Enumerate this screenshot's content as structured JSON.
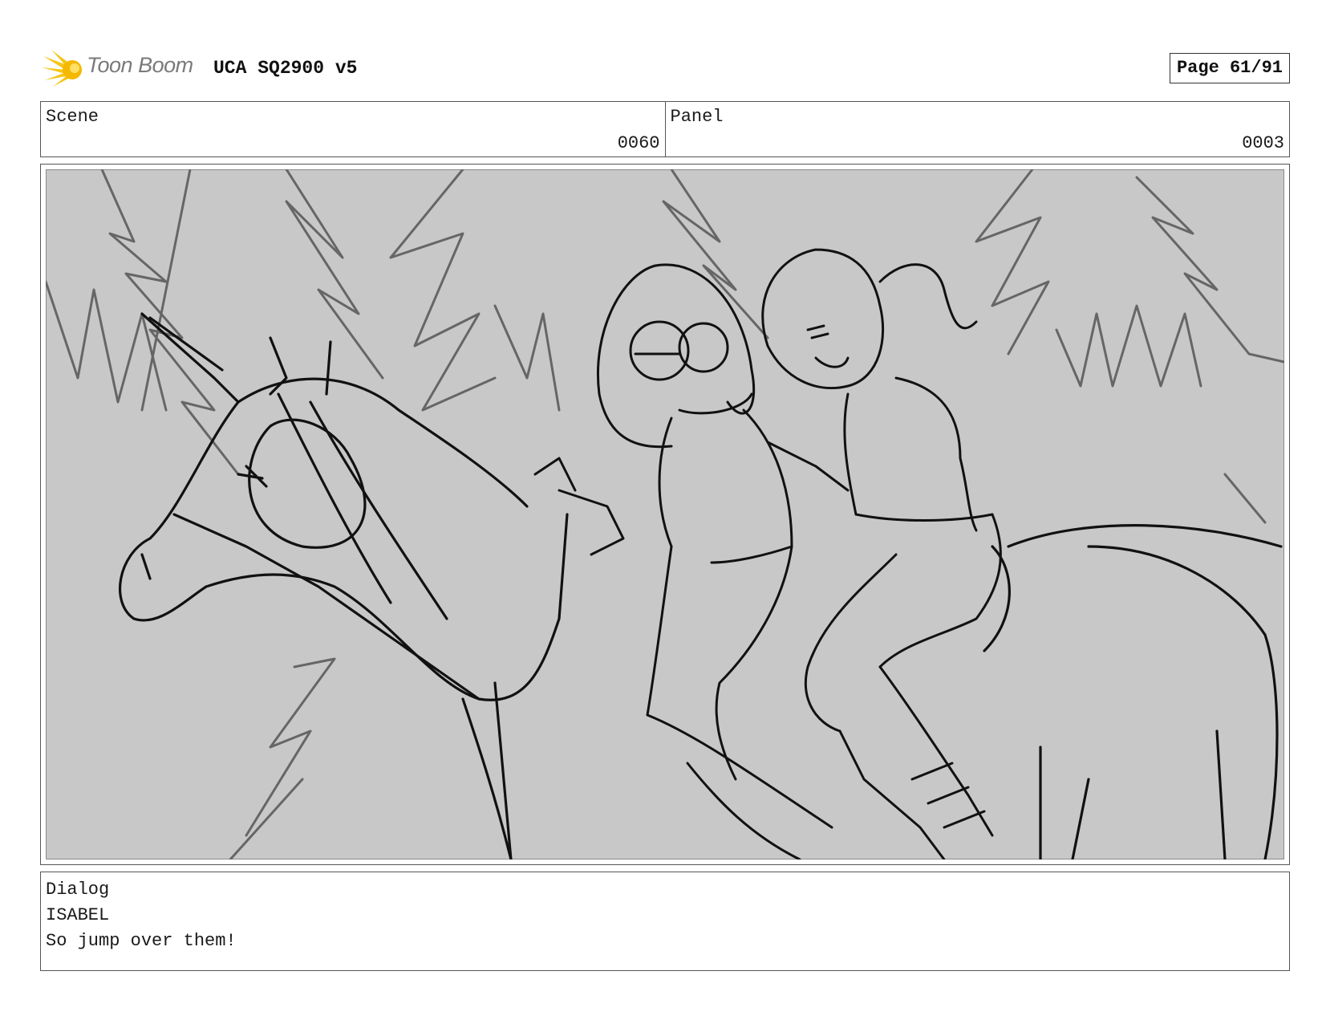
{
  "header": {
    "brand_name": "Toon Boom",
    "document_title": "UCA SQ2900 v5",
    "page_indicator": "Page 61/91",
    "logo_icon": "toon-boom-burst-icon",
    "logo_color": "#F5C518"
  },
  "scene": {
    "label": "Scene",
    "value": "0060"
  },
  "panel": {
    "label": "Panel",
    "value": "0003"
  },
  "artwork": {
    "background_color": "#C8C8C8",
    "line_color": "#111111",
    "tree_line_color": "#666666"
  },
  "dialog": {
    "label": "Dialog",
    "character": "ISABEL",
    "line": "So jump over them!"
  }
}
